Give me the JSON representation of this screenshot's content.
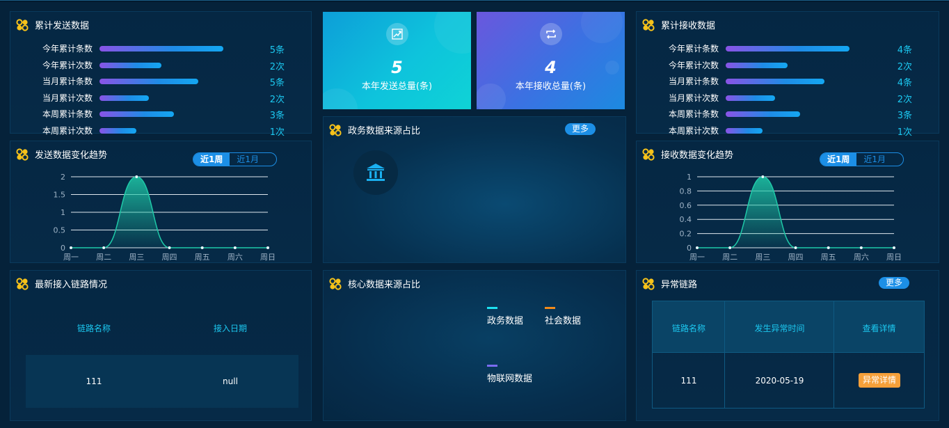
{
  "send_panel": {
    "title": "累计发送数据",
    "rows": [
      {
        "label": "今年累计条数",
        "value": "5条",
        "ratio": 1.0
      },
      {
        "label": "今年累计次数",
        "value": "2次",
        "ratio": 0.5
      },
      {
        "label": "当月累计条数",
        "value": "5条",
        "ratio": 0.8
      },
      {
        "label": "当月累计次数",
        "value": "2次",
        "ratio": 0.4
      },
      {
        "label": "本周累计条数",
        "value": "3条",
        "ratio": 0.6
      },
      {
        "label": "本周累计次数",
        "value": "1次",
        "ratio": 0.3
      }
    ]
  },
  "receive_panel": {
    "title": "累计接收数据",
    "rows": [
      {
        "label": "今年累计条数",
        "value": "4条",
        "ratio": 1.0
      },
      {
        "label": "今年累计次数",
        "value": "2次",
        "ratio": 0.5
      },
      {
        "label": "当月累计条数",
        "value": "4条",
        "ratio": 0.8
      },
      {
        "label": "当月累计次数",
        "value": "2次",
        "ratio": 0.4
      },
      {
        "label": "本周累计条数",
        "value": "3条",
        "ratio": 0.6
      },
      {
        "label": "本周累计次数",
        "value": "1次",
        "ratio": 0.3
      }
    ]
  },
  "tiles": {
    "send": {
      "number": "5",
      "caption": "本年发送总量(条)",
      "icon": "trend-up-icon"
    },
    "receive": {
      "number": "4",
      "caption": "本年接收总量(条)",
      "icon": "repeat-icon"
    }
  },
  "gov_panel": {
    "title": "政务数据来源占比",
    "more": "更多",
    "icon": "bank-icon"
  },
  "send_trend": {
    "title": "发送数据变化趋势",
    "tab_week": "近1周",
    "tab_month": "近1月"
  },
  "receive_trend": {
    "title": "接收数据变化趋势",
    "tab_week": "近1周",
    "tab_month": "近1月"
  },
  "links_panel": {
    "title": "最新接入链路情况",
    "headers": [
      "链路名称",
      "接入日期"
    ],
    "rows": [
      [
        "111",
        "null"
      ]
    ]
  },
  "core_panel": {
    "title": "核心数据来源占比",
    "legend": [
      {
        "label": "政务数据",
        "color": "#1de0f0"
      },
      {
        "label": "社会数据",
        "color": "#f08a1a"
      },
      {
        "label": "物联网数据",
        "color": "#7a6cf0"
      }
    ]
  },
  "abnormal_panel": {
    "title": "异常链路",
    "more": "更多",
    "headers": [
      "链路名称",
      "发生异常时间",
      "查看详情"
    ],
    "rows": [
      {
        "name": "111",
        "time": "2020-05-19",
        "action": "异常详情"
      }
    ]
  },
  "chart_data": [
    {
      "type": "area",
      "categories": [
        "周一",
        "周二",
        "周三",
        "周四",
        "周五",
        "周六",
        "周日"
      ],
      "values": [
        0,
        0,
        2,
        0,
        0,
        0,
        0
      ],
      "ylim": [
        0,
        2
      ],
      "yticks": [
        "0",
        "0.5",
        "1",
        "1.5",
        "2"
      ],
      "color": "#1fc9a8"
    },
    {
      "type": "area",
      "categories": [
        "周一",
        "周二",
        "周三",
        "周四",
        "周五",
        "周六",
        "周日"
      ],
      "values": [
        0,
        0,
        1,
        0,
        0,
        0,
        0
      ],
      "ylim": [
        0,
        1
      ],
      "yticks": [
        "0",
        "0.2",
        "0.4",
        "0.6",
        "0.8",
        "1"
      ],
      "color": "#1fc9a8"
    }
  ]
}
